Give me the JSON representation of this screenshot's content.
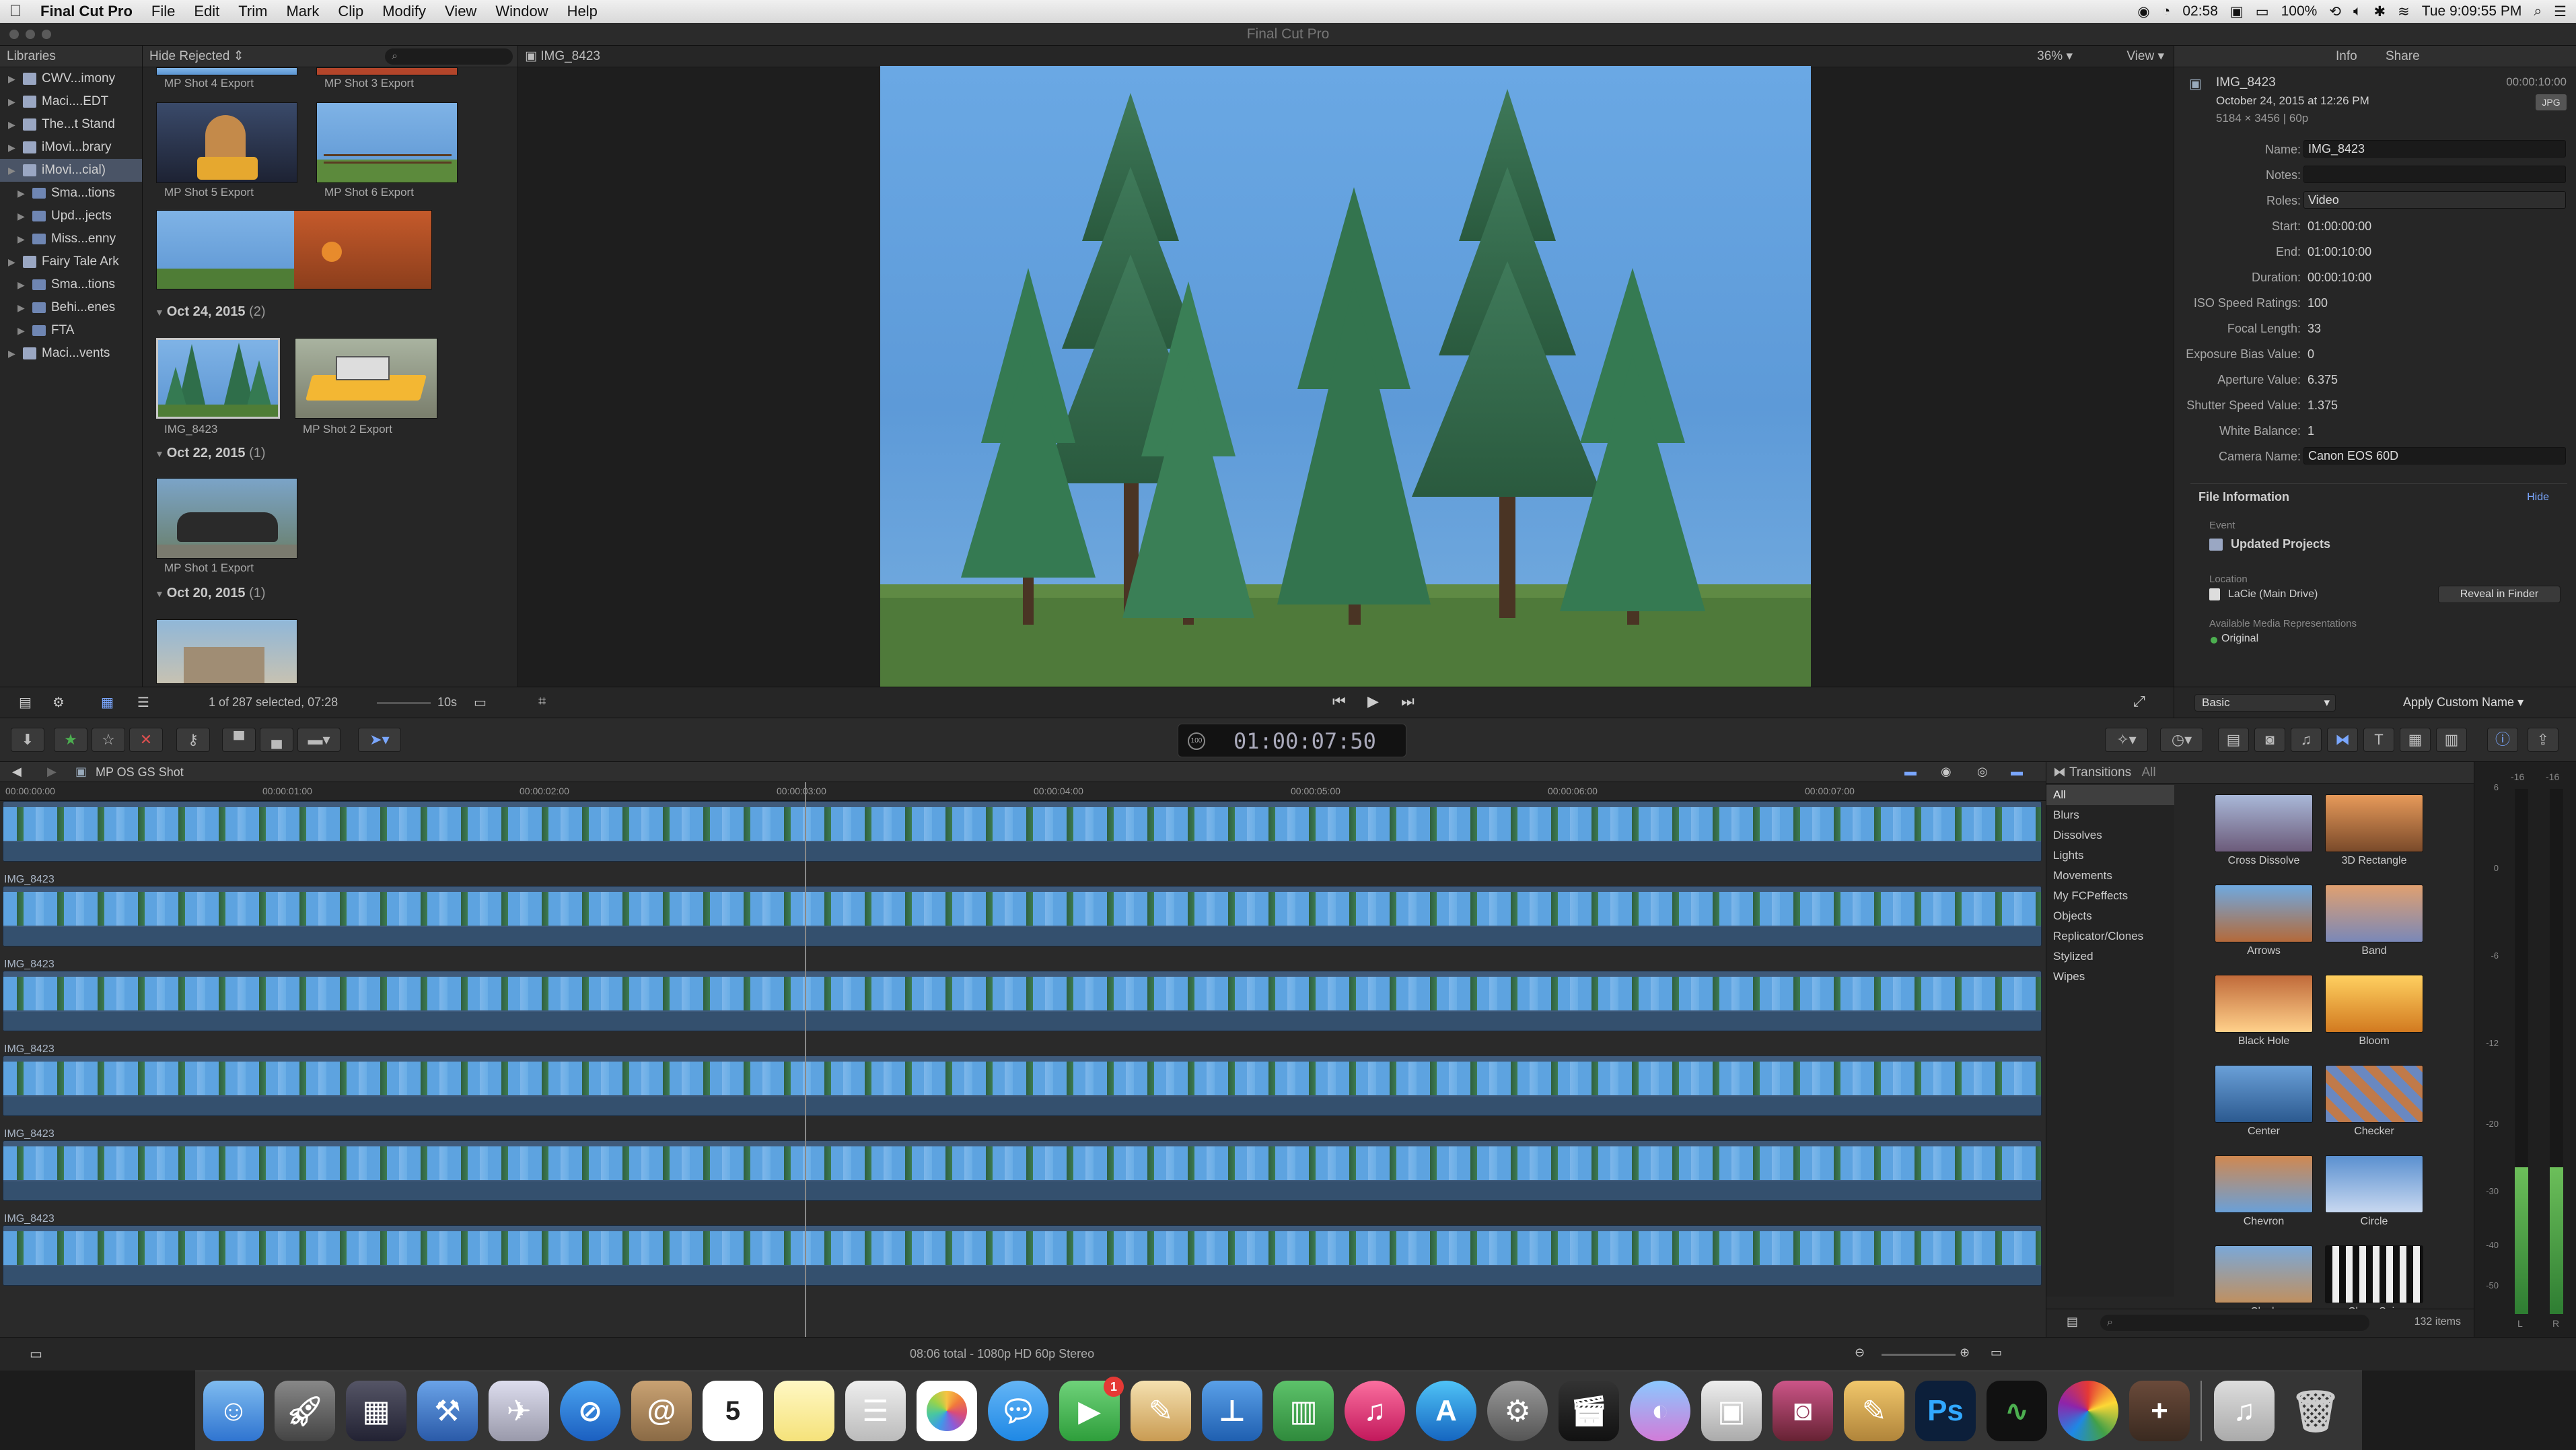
{
  "menubar": {
    "app": "Final Cut Pro",
    "items": [
      "File",
      "Edit",
      "Trim",
      "Mark",
      "Clip",
      "Modify",
      "View",
      "Window",
      "Help"
    ],
    "time": "02:58",
    "battery": "100%",
    "clock": "Tue 9:09:55 PM"
  },
  "window": {
    "title": "Final Cut Pro"
  },
  "libraries": {
    "header": "Libraries",
    "items": [
      {
        "label": "CWV...imony",
        "level": 0,
        "selected": false
      },
      {
        "label": "Maci....EDT",
        "level": 0,
        "selected": false
      },
      {
        "label": "The...t Stand",
        "level": 0,
        "selected": false
      },
      {
        "label": "iMovi...brary",
        "level": 0,
        "selected": false
      },
      {
        "label": "iMovi...cial)",
        "level": 0,
        "selected": true
      },
      {
        "label": "Sma...tions",
        "level": 1,
        "selected": false
      },
      {
        "label": "Upd...jects",
        "level": 1,
        "selected": false
      },
      {
        "label": "Miss...enny",
        "level": 1,
        "selected": false
      },
      {
        "label": "Fairy Tale Ark",
        "level": 0,
        "selected": false
      },
      {
        "label": "Sma...tions",
        "level": 1,
        "selected": false
      },
      {
        "label": "Behi...enes",
        "level": 1,
        "selected": false
      },
      {
        "label": "FTA",
        "level": 1,
        "selected": false
      },
      {
        "label": "Maci...vents",
        "level": 0,
        "selected": false
      }
    ]
  },
  "browser": {
    "filter": "Hide Rejected",
    "captions": {
      "mp4": "MP Shot 4 Export",
      "mp3": "MP Shot 3 Export",
      "mp5": "MP Shot 5 Export",
      "mp6": "MP Shot 6 Export",
      "img": "IMG_8423",
      "mp2": "MP Shot 2 Export",
      "mp1": "MP Shot 1 Export"
    },
    "groups": [
      {
        "date": "Oct 24, 2015",
        "count": "(2)"
      },
      {
        "date": "Oct 22, 2015",
        "count": "(1)"
      },
      {
        "date": "Oct 20, 2015",
        "count": "(1)"
      }
    ],
    "status": "1 of 287 selected, 07:28",
    "duration": "10s"
  },
  "viewer": {
    "clip": "IMG_8423",
    "zoom": "36%",
    "view": "View"
  },
  "inspector": {
    "tabs": [
      "Info",
      "Share"
    ],
    "name": "IMG_8423",
    "date": "October 24, 2015 at 12:26 PM",
    "format": "5184 × 3456  |  60p",
    "timecode": "00:00:10:00",
    "fields": [
      {
        "label": "Name:",
        "value": "IMG_8423",
        "type": "input"
      },
      {
        "label": "Notes:",
        "value": "",
        "type": "input"
      },
      {
        "label": "Roles:",
        "value": "Video",
        "type": "select"
      },
      {
        "label": "Start:",
        "value": "01:00:00:00",
        "type": "text"
      },
      {
        "label": "End:",
        "value": "01:00:10:00",
        "type": "text"
      },
      {
        "label": "Duration:",
        "value": "00:00:10:00",
        "type": "text"
      },
      {
        "label": "ISO Speed Ratings:",
        "value": "100",
        "type": "text"
      },
      {
        "label": "Focal Length:",
        "value": "33",
        "type": "text"
      },
      {
        "label": "Exposure Bias Value:",
        "value": "0",
        "type": "text"
      },
      {
        "label": "Aperture Value:",
        "value": "6.375",
        "type": "text"
      },
      {
        "label": "Shutter Speed Value:",
        "value": "1.375",
        "type": "text"
      },
      {
        "label": "White Balance:",
        "value": "1",
        "type": "text"
      },
      {
        "label": "Camera Name:",
        "value": "Canon EOS 60D",
        "type": "input"
      }
    ],
    "file_info": {
      "title": "File Information",
      "hide": "Hide",
      "event_label": "Event",
      "event": "Updated Projects",
      "location_label": "Location",
      "location": "LaCie (Main Drive)",
      "reveal": "Reveal in Finder",
      "reps_label": "Available Media Representations",
      "rep": "Original"
    },
    "metadata_view": "Basic",
    "apply": "Apply Custom Name"
  },
  "toolbar": {
    "timecode": "01:00:07:50"
  },
  "timeline": {
    "project": "MP OS GS Shot",
    "ruler": [
      "00:00:00:00",
      "00:00:01:00",
      "00:00:02:00",
      "00:00:03:00",
      "00:00:04:00",
      "00:00:05:00",
      "00:00:06:00",
      "00:00:07:00"
    ],
    "clip_label": "IMG_8423",
    "status": "08:06 total - 1080p HD 60p Stereo"
  },
  "transitions": {
    "header": "Transitions",
    "scope": "All",
    "categories": [
      "All",
      "Blurs",
      "Dissolves",
      "Lights",
      "Movements",
      "My FCPeffects",
      "Objects",
      "Replicator/Clones",
      "Stylized",
      "Wipes"
    ],
    "items": [
      "Cross Dissolve",
      "3D Rectangle",
      "Arrows",
      "Band",
      "Black Hole",
      "Bloom",
      "Center",
      "Checker",
      "Chevron",
      "Circle",
      "Clock",
      "Clone Spin"
    ],
    "count": "132 items"
  },
  "meters": {
    "scale": [
      "6",
      "0",
      "-6",
      "-12",
      "-20",
      "-30",
      "-40",
      "-50"
    ],
    "ch": [
      "-16",
      "-16"
    ],
    "lr": [
      "L",
      "R"
    ]
  },
  "dock": {
    "calendar_day": "5",
    "facetime_badge": "1",
    "ps": "Ps"
  }
}
